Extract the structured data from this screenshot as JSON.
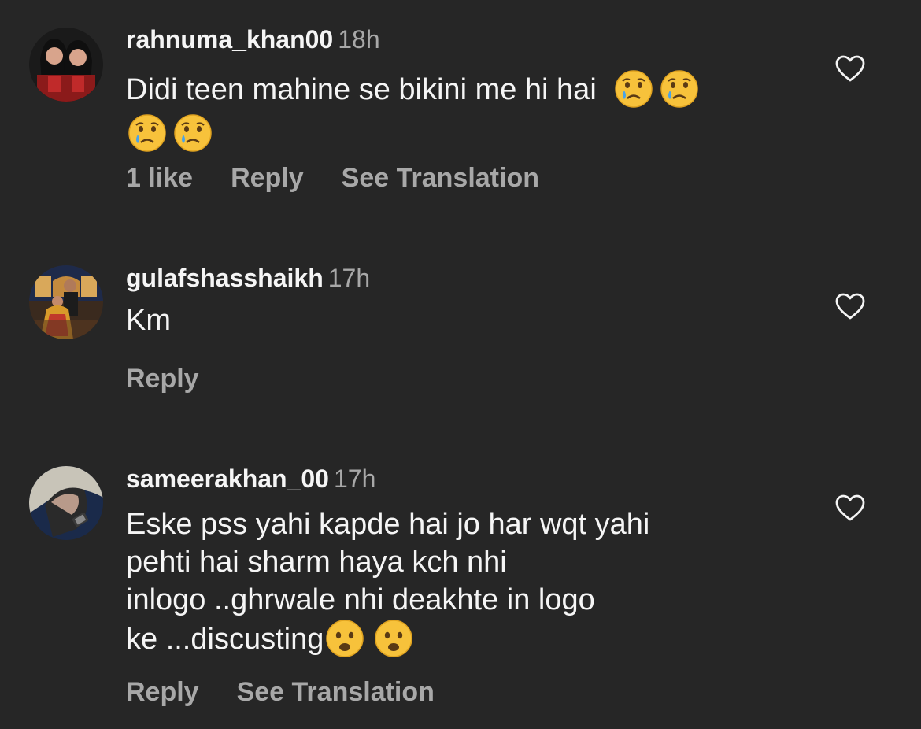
{
  "comments": [
    {
      "username": "rahnuma_khan00",
      "time": "18h",
      "text": "Didi teen mahine se bikini me hi hai",
      "emojis": [
        "crying-face",
        "crying-face",
        "crying-face",
        "crying-face"
      ],
      "likes": "1 like",
      "reply": "Reply",
      "translate": "See Translation"
    },
    {
      "username": "gulafshasshaikh",
      "time": "17h",
      "text": "Km",
      "reply": "Reply"
    },
    {
      "username": "sameerakhan_00",
      "time": "17h",
      "text_lines": [
        "Eske pss yahi kapde hai jo har wqt yahi",
        "pehti hai sharm haya kch nhi",
        "inlogo ..ghrwale nhi deakhte in logo",
        "ke ...discusting"
      ],
      "emojis": [
        "frowning-face",
        "frowning-face"
      ],
      "reply": "Reply",
      "translate": "See Translation"
    }
  ],
  "colors": {
    "background": "#262626",
    "primary_text": "#f5f5f5",
    "secondary_text": "#a8a8a8"
  }
}
